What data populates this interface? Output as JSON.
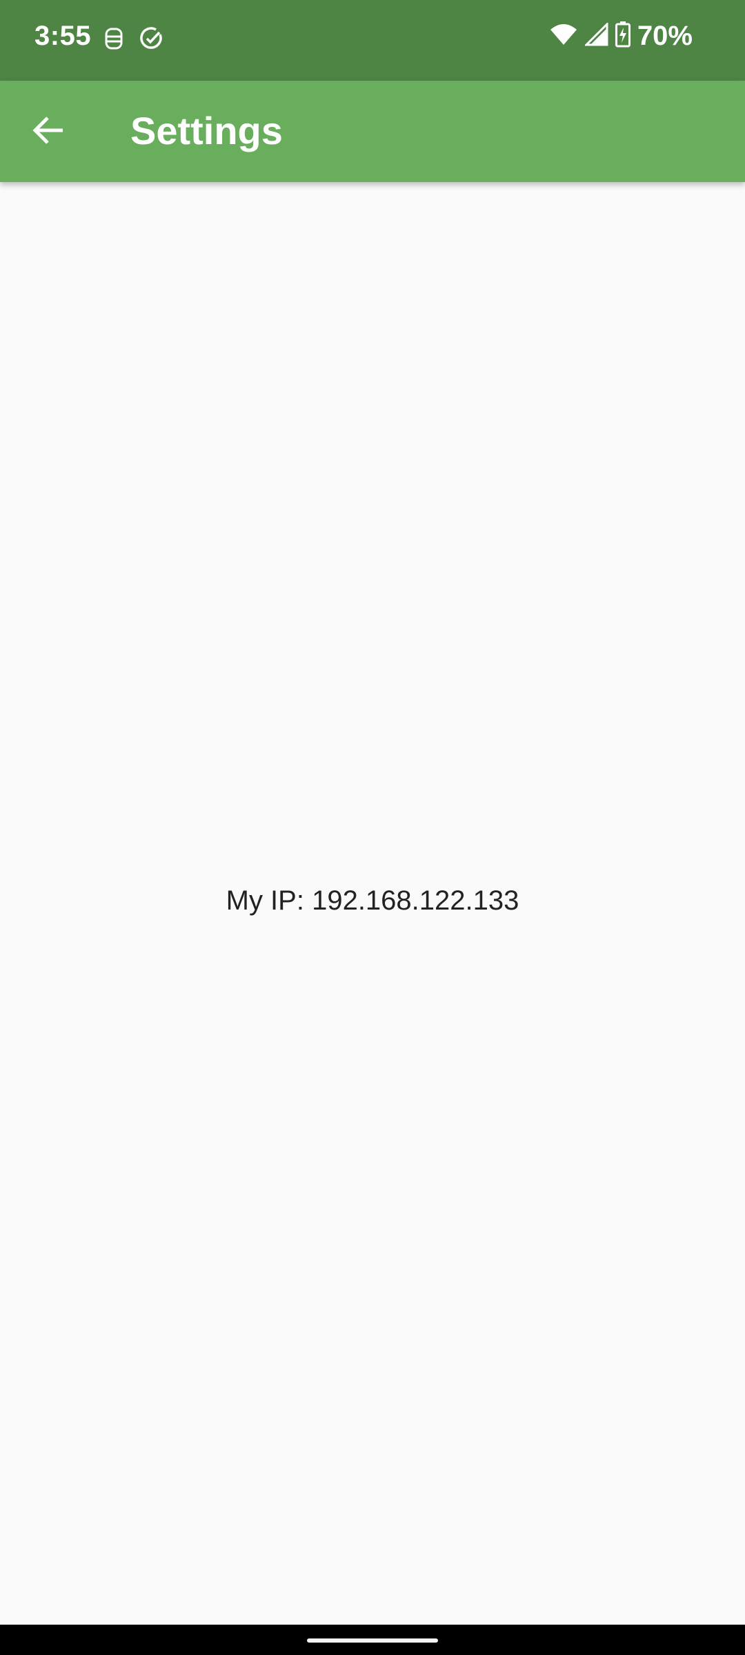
{
  "status_bar": {
    "time": "3:55",
    "battery": "70%",
    "icons": [
      "sim-icon",
      "check-circle-icon",
      "wifi-icon",
      "signal-icon",
      "battery-icon"
    ]
  },
  "app_bar": {
    "title": "Settings",
    "back_icon": "arrow-back-icon"
  },
  "content": {
    "ip_text": "My IP: 192.168.122.133"
  },
  "colors": {
    "status_bar": "#4e8444",
    "app_bar": "#69ae5d",
    "background": "#fafafa"
  }
}
